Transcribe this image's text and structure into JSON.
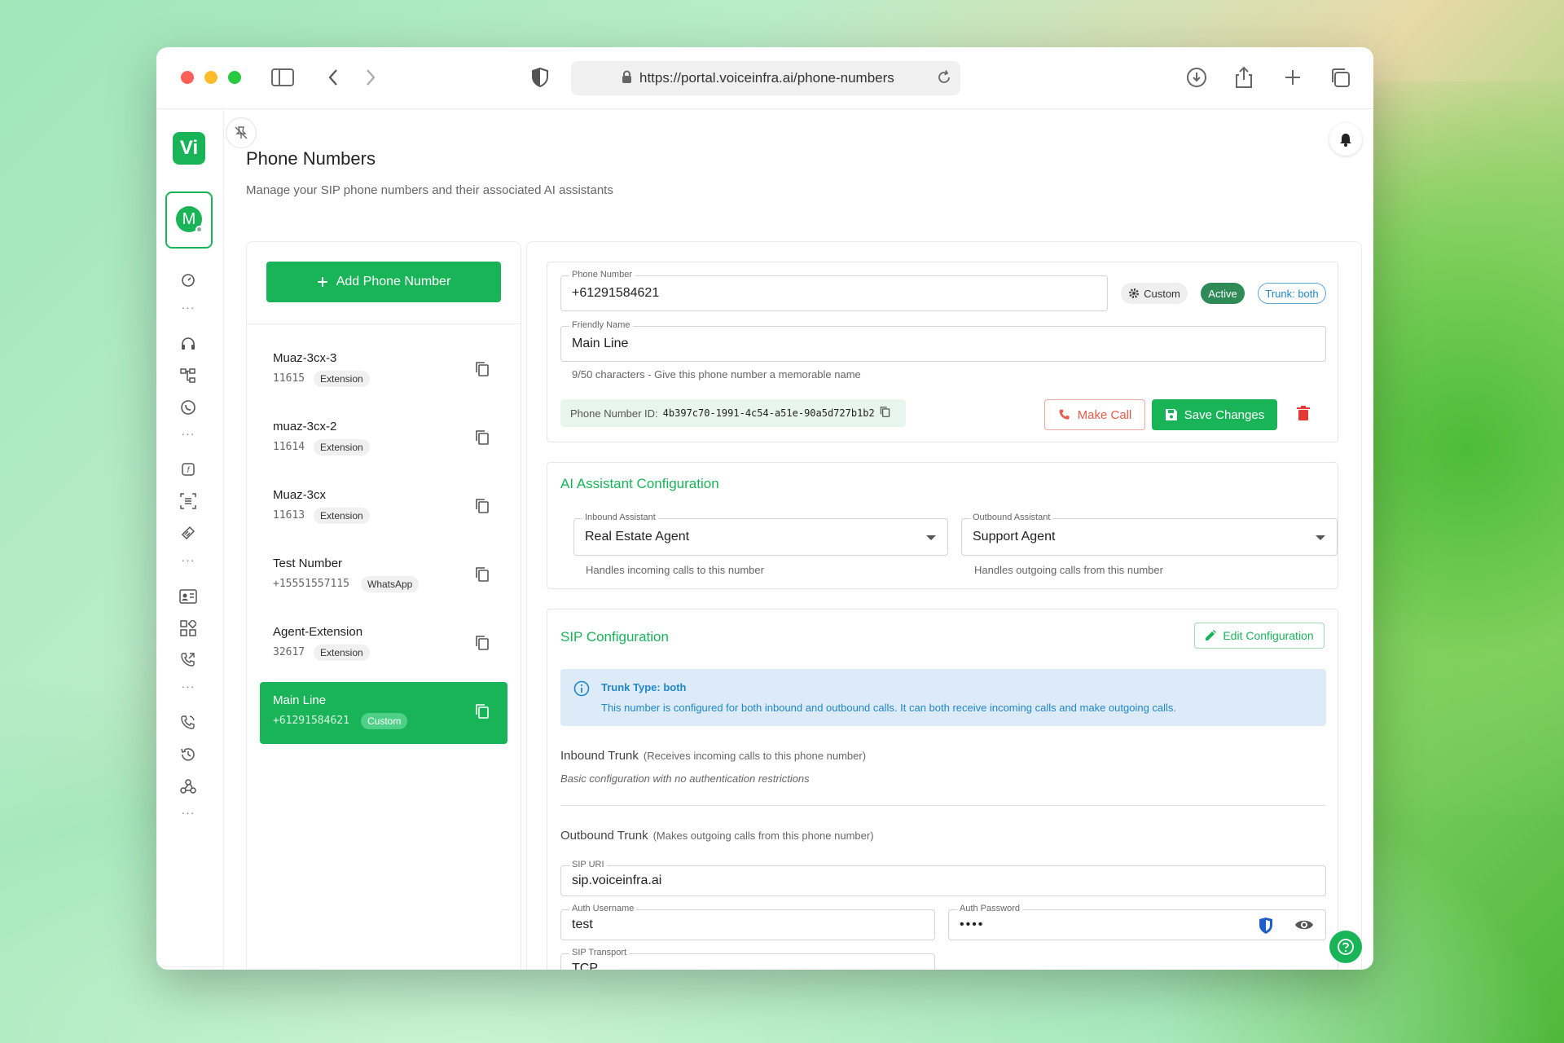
{
  "browser": {
    "url": "https://portal.voiceinfra.ai/phone-numbers"
  },
  "app": {
    "logo_text": "Vi",
    "org_initial": "M"
  },
  "page": {
    "title": "Phone Numbers",
    "subtitle": "Manage your SIP phone numbers and their associated AI assistants"
  },
  "list": {
    "add_label": "Add Phone Number",
    "items": [
      {
        "name": "Muaz-3cx-3",
        "number": "11615",
        "badge": "Extension"
      },
      {
        "name": "muaz-3cx-2",
        "number": "11614",
        "badge": "Extension"
      },
      {
        "name": "Muaz-3cx",
        "number": "11613",
        "badge": "Extension"
      },
      {
        "name": "Test Number",
        "number": "+15551557115",
        "badge": "WhatsApp"
      },
      {
        "name": "Agent-Extension",
        "number": "32617",
        "badge": "Extension"
      },
      {
        "name": "Main Line",
        "number": "+61291584621",
        "badge": "Custom"
      }
    ]
  },
  "detail": {
    "phone_label": "Phone Number",
    "phone_value": "+61291584621",
    "chip_custom": "Custom",
    "chip_active": "Active",
    "chip_trunk": "Trunk: both",
    "friendly_label": "Friendly Name",
    "friendly_value": "Main Line",
    "friendly_help": "9/50 characters - Give this phone number a memorable name",
    "id_label": "Phone Number ID:",
    "id_value": "4b397c70-1991-4c54-a51e-90a5d727b1b2",
    "make_call": "Make Call",
    "save_changes": "Save Changes"
  },
  "ai": {
    "title": "AI Assistant Configuration",
    "inbound_label": "Inbound Assistant",
    "inbound_value": "Real Estate Agent",
    "inbound_help": "Handles incoming calls to this number",
    "outbound_label": "Outbound Assistant",
    "outbound_value": "Support Agent",
    "outbound_help": "Handles outgoing calls from this number"
  },
  "sip": {
    "title": "SIP Configuration",
    "edit_label": "Edit Configuration",
    "info_title": "Trunk Type: both",
    "info_text": "This number is configured for both inbound and outbound calls. It can both receive incoming calls and make outgoing calls.",
    "inbound_title": "Inbound Trunk",
    "inbound_hint": "(Receives incoming calls to this phone number)",
    "inbound_note": "Basic configuration with no authentication restrictions",
    "outbound_title": "Outbound Trunk",
    "outbound_hint": "(Makes outgoing calls from this phone number)",
    "uri_label": "SIP URI",
    "uri_value": "sip.voiceinfra.ai",
    "user_label": "Auth Username",
    "user_value": "test",
    "pass_label": "Auth Password",
    "pass_value": "••••",
    "transport_label": "SIP Transport",
    "transport_value": "TCP"
  },
  "colors": {
    "brand": "#1ab458",
    "danger": "#e53935",
    "info": "#1f86c9"
  }
}
